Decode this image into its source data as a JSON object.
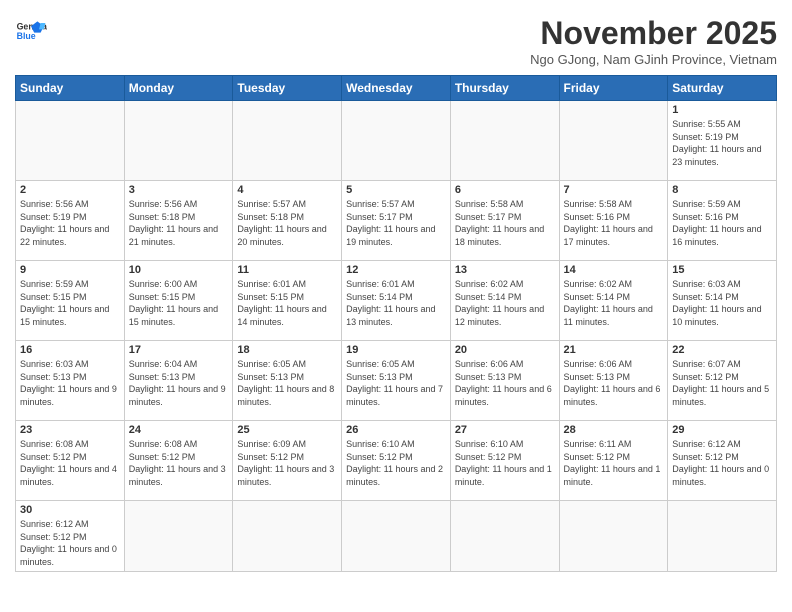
{
  "header": {
    "logo_line1": "General",
    "logo_line2": "Blue",
    "month_title": "November 2025",
    "subtitle": "Ngo GJong, Nam GJinh Province, Vietnam"
  },
  "days_of_week": [
    "Sunday",
    "Monday",
    "Tuesday",
    "Wednesday",
    "Thursday",
    "Friday",
    "Saturday"
  ],
  "weeks": [
    [
      {
        "day": "",
        "info": ""
      },
      {
        "day": "",
        "info": ""
      },
      {
        "day": "",
        "info": ""
      },
      {
        "day": "",
        "info": ""
      },
      {
        "day": "",
        "info": ""
      },
      {
        "day": "",
        "info": ""
      },
      {
        "day": "1",
        "info": "Sunrise: 5:55 AM\nSunset: 5:19 PM\nDaylight: 11 hours\nand 23 minutes."
      }
    ],
    [
      {
        "day": "2",
        "info": "Sunrise: 5:56 AM\nSunset: 5:19 PM\nDaylight: 11 hours\nand 22 minutes."
      },
      {
        "day": "3",
        "info": "Sunrise: 5:56 AM\nSunset: 5:18 PM\nDaylight: 11 hours\nand 21 minutes."
      },
      {
        "day": "4",
        "info": "Sunrise: 5:57 AM\nSunset: 5:18 PM\nDaylight: 11 hours\nand 20 minutes."
      },
      {
        "day": "5",
        "info": "Sunrise: 5:57 AM\nSunset: 5:17 PM\nDaylight: 11 hours\nand 19 minutes."
      },
      {
        "day": "6",
        "info": "Sunrise: 5:58 AM\nSunset: 5:17 PM\nDaylight: 11 hours\nand 18 minutes."
      },
      {
        "day": "7",
        "info": "Sunrise: 5:58 AM\nSunset: 5:16 PM\nDaylight: 11 hours\nand 17 minutes."
      },
      {
        "day": "8",
        "info": "Sunrise: 5:59 AM\nSunset: 5:16 PM\nDaylight: 11 hours\nand 16 minutes."
      }
    ],
    [
      {
        "day": "9",
        "info": "Sunrise: 5:59 AM\nSunset: 5:15 PM\nDaylight: 11 hours\nand 15 minutes."
      },
      {
        "day": "10",
        "info": "Sunrise: 6:00 AM\nSunset: 5:15 PM\nDaylight: 11 hours\nand 15 minutes."
      },
      {
        "day": "11",
        "info": "Sunrise: 6:01 AM\nSunset: 5:15 PM\nDaylight: 11 hours\nand 14 minutes."
      },
      {
        "day": "12",
        "info": "Sunrise: 6:01 AM\nSunset: 5:14 PM\nDaylight: 11 hours\nand 13 minutes."
      },
      {
        "day": "13",
        "info": "Sunrise: 6:02 AM\nSunset: 5:14 PM\nDaylight: 11 hours\nand 12 minutes."
      },
      {
        "day": "14",
        "info": "Sunrise: 6:02 AM\nSunset: 5:14 PM\nDaylight: 11 hours\nand 11 minutes."
      },
      {
        "day": "15",
        "info": "Sunrise: 6:03 AM\nSunset: 5:14 PM\nDaylight: 11 hours\nand 10 minutes."
      }
    ],
    [
      {
        "day": "16",
        "info": "Sunrise: 6:03 AM\nSunset: 5:13 PM\nDaylight: 11 hours\nand 9 minutes."
      },
      {
        "day": "17",
        "info": "Sunrise: 6:04 AM\nSunset: 5:13 PM\nDaylight: 11 hours\nand 9 minutes."
      },
      {
        "day": "18",
        "info": "Sunrise: 6:05 AM\nSunset: 5:13 PM\nDaylight: 11 hours\nand 8 minutes."
      },
      {
        "day": "19",
        "info": "Sunrise: 6:05 AM\nSunset: 5:13 PM\nDaylight: 11 hours\nand 7 minutes."
      },
      {
        "day": "20",
        "info": "Sunrise: 6:06 AM\nSunset: 5:13 PM\nDaylight: 11 hours\nand 6 minutes."
      },
      {
        "day": "21",
        "info": "Sunrise: 6:06 AM\nSunset: 5:13 PM\nDaylight: 11 hours\nand 6 minutes."
      },
      {
        "day": "22",
        "info": "Sunrise: 6:07 AM\nSunset: 5:12 PM\nDaylight: 11 hours\nand 5 minutes."
      }
    ],
    [
      {
        "day": "23",
        "info": "Sunrise: 6:08 AM\nSunset: 5:12 PM\nDaylight: 11 hours\nand 4 minutes."
      },
      {
        "day": "24",
        "info": "Sunrise: 6:08 AM\nSunset: 5:12 PM\nDaylight: 11 hours\nand 3 minutes."
      },
      {
        "day": "25",
        "info": "Sunrise: 6:09 AM\nSunset: 5:12 PM\nDaylight: 11 hours\nand 3 minutes."
      },
      {
        "day": "26",
        "info": "Sunrise: 6:10 AM\nSunset: 5:12 PM\nDaylight: 11 hours\nand 2 minutes."
      },
      {
        "day": "27",
        "info": "Sunrise: 6:10 AM\nSunset: 5:12 PM\nDaylight: 11 hours\nand 1 minute."
      },
      {
        "day": "28",
        "info": "Sunrise: 6:11 AM\nSunset: 5:12 PM\nDaylight: 11 hours\nand 1 minute."
      },
      {
        "day": "29",
        "info": "Sunrise: 6:12 AM\nSunset: 5:12 PM\nDaylight: 11 hours\nand 0 minutes."
      }
    ],
    [
      {
        "day": "30",
        "info": "Sunrise: 6:12 AM\nSunset: 5:12 PM\nDaylight: 11 hours\nand 0 minutes."
      },
      {
        "day": "",
        "info": ""
      },
      {
        "day": "",
        "info": ""
      },
      {
        "day": "",
        "info": ""
      },
      {
        "day": "",
        "info": ""
      },
      {
        "day": "",
        "info": ""
      },
      {
        "day": "",
        "info": ""
      }
    ]
  ]
}
